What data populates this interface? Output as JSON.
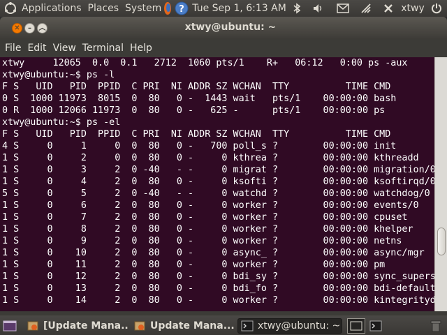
{
  "top_panel": {
    "menus": [
      "Applications",
      "Places",
      "System"
    ],
    "clock": "Tue Sep  1,  6:13 AM",
    "user": "xtwy"
  },
  "window": {
    "title": "xtwy@ubuntu: ~",
    "menu": [
      "File",
      "Edit",
      "View",
      "Terminal",
      "Help"
    ]
  },
  "terminal": {
    "lines": [
      "xtwy     12065  0.0  0.1   2712  1060 pts/1    R+   06:12   0:00 ps -aux",
      "xtwy@ubuntu:~$ ps -l",
      "F S   UID   PID  PPID  C PRI  NI ADDR SZ WCHAN  TTY          TIME CMD",
      "0 S  1000 11973  8015  0  80   0 -  1443 wait   pts/1    00:00:00 bash",
      "0 R  1000 12066 11973  0  80   0 -   625 -      pts/1    00:00:00 ps",
      "xtwy@ubuntu:~$ ps -el",
      "F S   UID   PID  PPID  C PRI  NI ADDR SZ WCHAN  TTY          TIME CMD",
      "4 S     0     1     0  0  80   0 -   700 poll_s ?        00:00:00 init",
      "1 S     0     2     0  0  80   0 -     0 kthrea ?        00:00:00 kthreadd",
      "1 S     0     3     2  0 -40   - -     0 migrat ?        00:00:00 migration/0",
      "1 S     0     4     2  0  80   0 -     0 ksofti ?        00:00:00 ksoftirqd/0",
      "5 S     0     5     2  0 -40   - -     0 watchd ?        00:00:00 watchdog/0",
      "1 S     0     6     2  0  80   0 -     0 worker ?        00:00:00 events/0",
      "1 S     0     7     2  0  80   0 -     0 worker ?        00:00:00 cpuset",
      "1 S     0     8     2  0  80   0 -     0 worker ?        00:00:00 khelper",
      "1 S     0     9     2  0  80   0 -     0 worker ?        00:00:00 netns",
      "1 S     0    10     2  0  80   0 -     0 async_ ?        00:00:00 async/mgr",
      "1 S     0    11     2  0  80   0 -     0 worker ?        00:00:00 pm",
      "1 S     0    12     2  0  80   0 -     0 bdi_sy ?        00:00:00 sync_supers",
      "1 S     0    13     2  0  80   0 -     0 bdi_fo ?        00:00:00 bdi-default",
      "1 S     0    14     2  0  80   0 -     0 worker ?        00:00:00 kintegrityd"
    ]
  },
  "taskbar": {
    "tasks": [
      "[Update Mana...",
      "Update Mana...",
      "xtwy@ubuntu: ~"
    ]
  },
  "colors": {
    "terminal_bg": "#300a24",
    "panel_bg": "#3c3b37",
    "close_button": "#f57900"
  },
  "icons": [
    "ubuntu-logo-icon",
    "firefox-icon",
    "help-icon",
    "bluetooth-icon",
    "volume-icon",
    "mail-icon",
    "network-icon",
    "power-icon",
    "show-desktop-icon",
    "update-manager-icon",
    "terminal-icon",
    "workspace-icon",
    "trash-icon"
  ]
}
